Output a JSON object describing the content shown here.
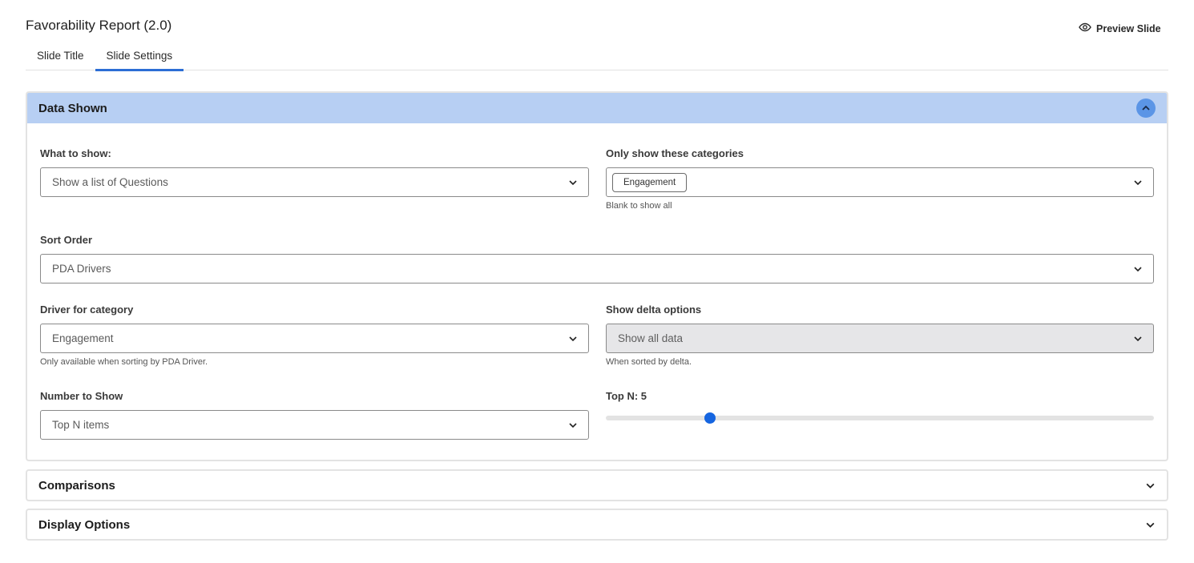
{
  "page": {
    "title": "Favorability Report (2.0)",
    "preview_label": "Preview Slide"
  },
  "tabs": [
    {
      "label": "Slide Title",
      "active": false
    },
    {
      "label": "Slide Settings",
      "active": true
    }
  ],
  "sections": {
    "data_shown": {
      "title": "Data Shown",
      "expanded": true,
      "what_to_show": {
        "label": "What to show:",
        "value": "Show a list of Questions"
      },
      "categories": {
        "label": "Only show these categories",
        "chips": [
          "Engagement"
        ],
        "helper": "Blank to show all"
      },
      "sort_order": {
        "label": "Sort Order",
        "value": "PDA Drivers"
      },
      "driver_for_category": {
        "label": "Driver for category",
        "value": "Engagement",
        "helper": "Only available when sorting by PDA Driver."
      },
      "delta_options": {
        "label": "Show delta options",
        "value": "Show all data",
        "disabled": true,
        "helper": "When sorted by delta."
      },
      "number_to_show": {
        "label": "Number to Show",
        "value": "Top N items"
      },
      "top_n": {
        "label": "Top N: 5",
        "value": 5,
        "fraction": 0.19
      }
    },
    "comparisons": {
      "title": "Comparisons",
      "expanded": false
    },
    "display_options": {
      "title": "Display Options",
      "expanded": false
    }
  },
  "icons": {
    "preview": "eye-icon",
    "collapse": "chevron-up-icon",
    "expand": "chevron-down-icon"
  },
  "colors": {
    "accent": "#2c6ed5",
    "header_bg": "#b7cff3",
    "slider_thumb": "#1565e0"
  }
}
